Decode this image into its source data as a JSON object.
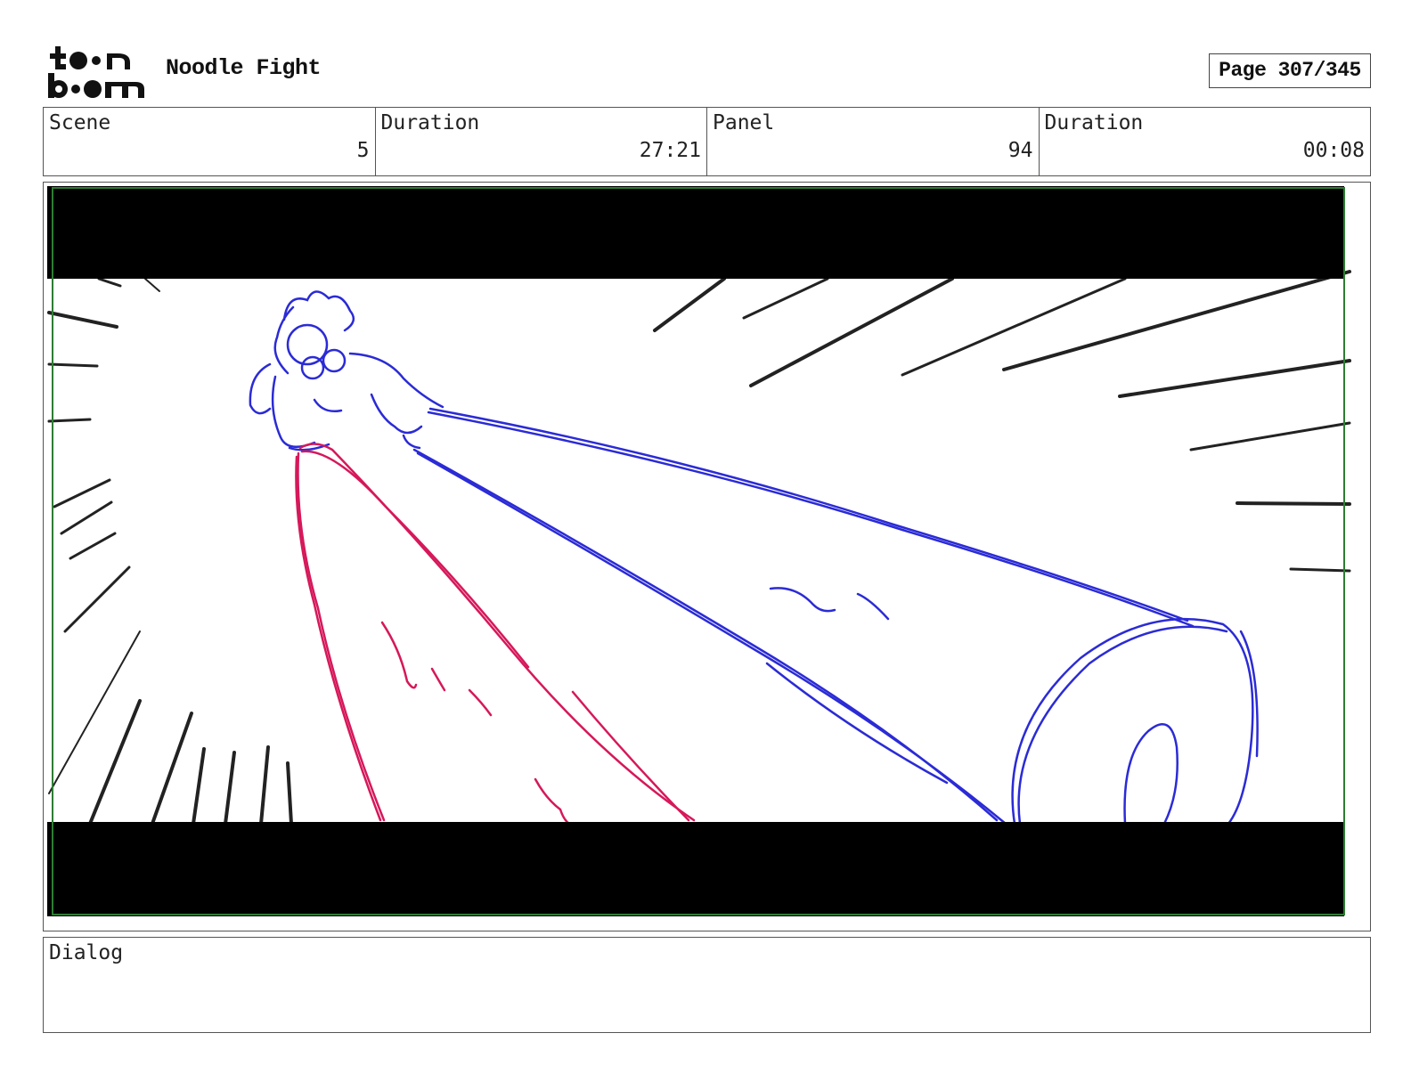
{
  "header": {
    "logo_text": "toon boom",
    "project_title": "Noodle Fight",
    "page_indicator": "Page 307/345"
  },
  "info": {
    "scene_label": "Scene",
    "scene_value": "5",
    "scene_duration_label": "Duration",
    "scene_duration_value": "27:21",
    "panel_label": "Panel",
    "panel_value": "94",
    "panel_duration_label": "Duration",
    "panel_duration_value": "00:08"
  },
  "panel": {
    "description": "",
    "colors": {
      "letterbox": "#000000",
      "frame_border": "#2e7d32",
      "speed_lines": "#222222",
      "noodle_blue": "#2b2bd6",
      "noodle_red": "#d6185a"
    }
  },
  "dialog": {
    "label": "Dialog",
    "text": ""
  }
}
